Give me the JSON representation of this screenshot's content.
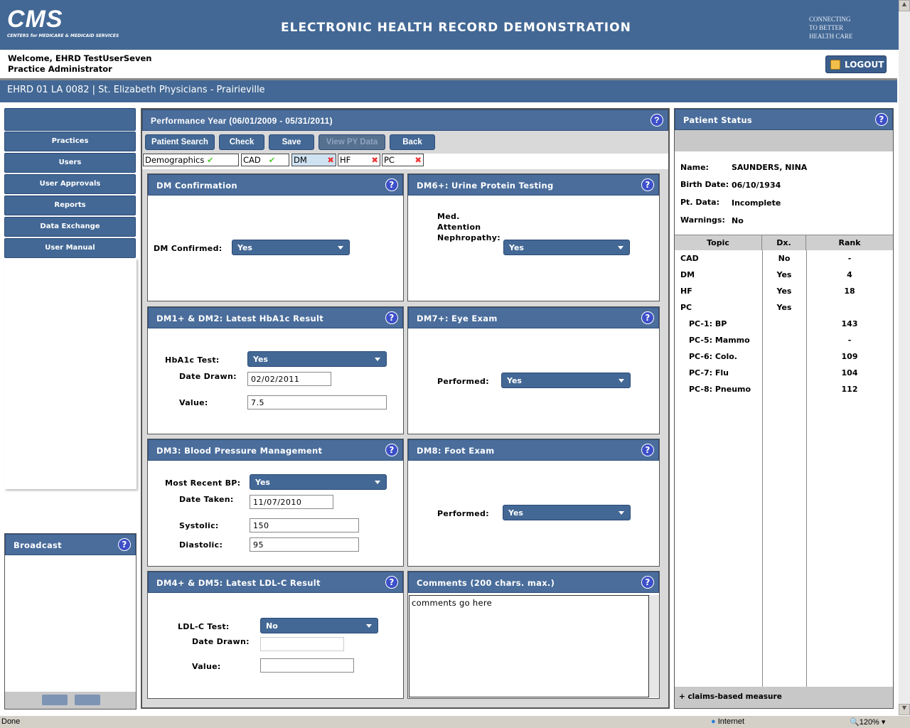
{
  "header": {
    "logo_text": "CMS",
    "logo_subtext": "CENTERS for MEDICARE & MEDICAID SERVICES",
    "title": "ELECTRONIC HEALTH RECORD DEMONSTRATION",
    "tagline": [
      "CONNECTING",
      "TO BETTER",
      "HEALTH CARE"
    ]
  },
  "user": {
    "welcome": "Welcome, EHRD TestUserSeven",
    "role": "Practice Administrator",
    "logout_label": "LOGOUT"
  },
  "org": "EHRD 01 LA 0082 | St. Elizabeth Physicians - Prairieville",
  "sidebar": {
    "items": [
      "Practices",
      "Users",
      "User Approvals",
      "Reports",
      "Data Exchange",
      "User Manual"
    ],
    "broadcast_title": "Broadcast"
  },
  "main": {
    "title": "Performance Year (06/01/2009 - 05/31/2011)",
    "toolbar": {
      "patient_search": "Patient Search",
      "check": "Check",
      "save": "Save",
      "view_py": "View PY Data",
      "back": "Back"
    },
    "tabs": [
      {
        "label": "Demographics",
        "status": "complete"
      },
      {
        "label": "CAD",
        "status": "complete"
      },
      {
        "label": "DM",
        "status": "incomplete",
        "active": true
      },
      {
        "label": "HF",
        "status": "incomplete"
      },
      {
        "label": "PC",
        "status": "incomplete"
      }
    ],
    "panels": {
      "dm_conf": {
        "title": "DM Confirmation",
        "label": "DM Confirmed:",
        "value": "Yes"
      },
      "dm6": {
        "title": "DM6+: Urine Protein Testing",
        "label": [
          "Med.",
          "Attention",
          "Nephropathy:"
        ],
        "value": "Yes"
      },
      "hba1c": {
        "title": "DM1+ & DM2: Latest HbA1c Result",
        "test_label": "HbA1c Test:",
        "test": "Yes",
        "date_label": "Date Drawn:",
        "date": "02/02/2011",
        "value_label": "Value:",
        "value": "7.5"
      },
      "eye": {
        "title": "DM7+: Eye Exam",
        "label": "Performed:",
        "value": "Yes"
      },
      "bp": {
        "title": "DM3: Blood Pressure Management",
        "recent_label": "Most Recent BP:",
        "recent": "Yes",
        "date_label": "Date Taken:",
        "date": "11/07/2010",
        "sys_label": "Systolic:",
        "sys": "150",
        "dia_label": "Diastolic:",
        "dia": "95"
      },
      "foot": {
        "title": "DM8: Foot Exam",
        "label": "Performed:",
        "value": "Yes"
      },
      "ldl": {
        "title": "DM4+ & DM5: Latest LDL-C Result",
        "test_label": "LDL-C Test:",
        "test": "No",
        "date_label": "Date Drawn:",
        "date": "",
        "value_label": "Value:",
        "value": ""
      },
      "comments": {
        "title": "Comments (200 chars. max.)",
        "text": "comments go here"
      }
    }
  },
  "status": {
    "title": "Patient Status",
    "name_label": "Name:",
    "name": "SAUNDERS, NINA",
    "birth_label": "Birth Date:",
    "birth": "06/10/1934",
    "pt_label": "Pt. Data:",
    "pt": "Incomplete",
    "warn_label": "Warnings:",
    "warn": "No",
    "columns": [
      "Topic",
      "Dx.",
      "Rank"
    ],
    "rows": [
      [
        "CAD",
        "No",
        "-"
      ],
      [
        "DM",
        "Yes",
        "4"
      ],
      [
        "HF",
        "Yes",
        "18"
      ],
      [
        "PC",
        "Yes",
        ""
      ],
      [
        "PC-1: BP",
        "",
        "143"
      ],
      [
        "PC-5: Mammo",
        "",
        "-"
      ],
      [
        "PC-6: Colo.",
        "",
        "109"
      ],
      [
        "PC-7: Flu",
        "",
        "104"
      ],
      [
        "PC-8: Pneumo",
        "",
        "112"
      ]
    ],
    "footnote": "+ claims-based measure"
  },
  "browser": {
    "status": "Done",
    "zone": "Internet",
    "zoom": "120%"
  },
  "colors": {
    "brand": "#436895",
    "panel_header": "#4a6d9b",
    "complete": "#55cc33",
    "incomplete": "#ee3333"
  }
}
